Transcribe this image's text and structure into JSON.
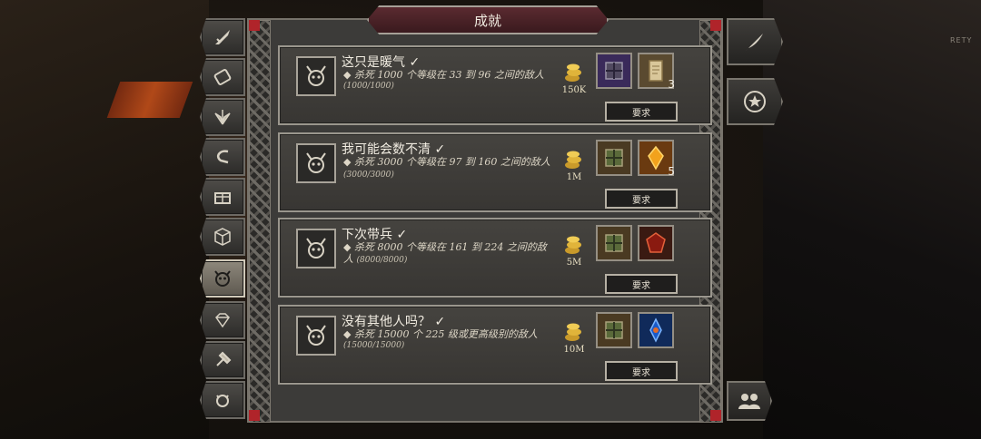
{
  "window": {
    "title": "成就"
  },
  "background": {
    "sign_text": "RETY"
  },
  "tabs": [
    {
      "name": "sword-tab",
      "icon": "sword-icon"
    },
    {
      "name": "scroll-tab",
      "icon": "scroll-icon"
    },
    {
      "name": "wings-tab",
      "icon": "wings-icon"
    },
    {
      "name": "hook-tab",
      "icon": "hook-icon"
    },
    {
      "name": "chest-tab",
      "icon": "chest-icon"
    },
    {
      "name": "cube-tab",
      "icon": "cube-icon"
    },
    {
      "name": "demon-skull-tab",
      "icon": "demon-skull-icon",
      "active": true
    },
    {
      "name": "gem-tab",
      "icon": "gem-icon"
    },
    {
      "name": "hammer-tab",
      "icon": "hammer-icon"
    },
    {
      "name": "pet-tab",
      "icon": "pet-icon"
    }
  ],
  "side_buttons": [
    {
      "name": "quill-button",
      "icon": "quill-icon"
    },
    {
      "name": "laurel-star-button",
      "icon": "laurel-star-icon"
    },
    {
      "name": "group-button",
      "icon": "group-icon"
    }
  ],
  "achievements": [
    {
      "title": "这只是暖气 ✓",
      "description": "◆ 杀死 1000 个等级在 33 到 96 之间的敌人",
      "progress": "(1000/1000)",
      "gold": "150K",
      "rewards": [
        {
          "icon": "purple-cube-icon",
          "color": "#3a2a5a",
          "qty": ""
        },
        {
          "icon": "parchment-scroll-icon",
          "color": "#5a4a30",
          "qty": "3"
        }
      ],
      "button": "要求"
    },
    {
      "title": "我可能会数不清 ✓",
      "description": "◆ 杀死 3000 个等级在 97 到 160 之间的敌人",
      "progress": "(3000/3000)",
      "gold": "1M",
      "rewards": [
        {
          "icon": "green-cube-icon",
          "color": "#4a3a22",
          "qty": ""
        },
        {
          "icon": "amber-gem-icon",
          "color": "#6a3a10",
          "qty": "5"
        }
      ],
      "button": "要求"
    },
    {
      "title": "下次带兵 ✓",
      "description": "◆ 杀死 8000 个等级在 161 到 224 之间的敌人",
      "progress": "(8000/8000)",
      "gold": "5M",
      "rewards": [
        {
          "icon": "green-cube-icon",
          "color": "#4a3a22",
          "qty": ""
        },
        {
          "icon": "red-gem-icon",
          "color": "#3a1a12",
          "qty": ""
        }
      ],
      "button": "要求"
    },
    {
      "title": "没有其他人吗？ ✓",
      "description": "◆ 杀死 15000 个 225 级或更高级别的敌人",
      "progress": "(15000/15000)",
      "gold": "10M",
      "rewards": [
        {
          "icon": "green-cube-icon",
          "color": "#4a3a22",
          "qty": ""
        },
        {
          "icon": "blue-shard-icon",
          "color": "#102a5a",
          "qty": ""
        }
      ],
      "button": "要求"
    }
  ]
}
